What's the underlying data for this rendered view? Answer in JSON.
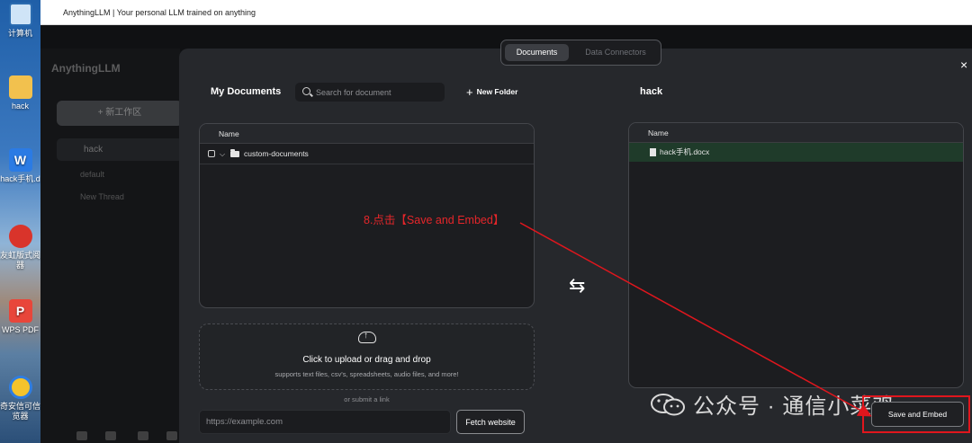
{
  "browser": {
    "title": "AnythingLLM | Your personal LLM trained on anything"
  },
  "desktop": {
    "icons": [
      {
        "label": "计算机"
      },
      {
        "label": "hack"
      },
      {
        "label": "hack手机.d"
      },
      {
        "label": "友虹版式阅器"
      },
      {
        "label": "WPS PDF"
      },
      {
        "label": "奇安信可信览器"
      }
    ]
  },
  "sidebar": {
    "logo": "AnythingLLM",
    "new_workspace": "+ 新工作区",
    "workspace": "hack",
    "threads": [
      "default",
      "New Thread"
    ]
  },
  "tabs": {
    "documents": "Documents",
    "connectors": "Data Connectors"
  },
  "left_panel": {
    "title": "My Documents",
    "search_placeholder": "Search for document",
    "new_folder": "New Folder",
    "column": "Name",
    "folders": [
      "custom-documents"
    ]
  },
  "upload": {
    "title": "Click to upload or drag and drop",
    "subtitle": "supports text files, csv's, spreadsheets, audio files, and more!",
    "or_link": "or submit a link",
    "url_placeholder": "https://example.com",
    "fetch_label": "Fetch website"
  },
  "right_panel": {
    "title": "hack",
    "column": "Name",
    "files": [
      "hack手机.docx"
    ],
    "save_label": "Save and Embed"
  },
  "annotation": {
    "text": "8.点击【Save and Embed】",
    "color": "#e0161d"
  },
  "watermark": {
    "text": "公众号 · 通信小菜鸡"
  },
  "close_symbol": "×",
  "swap_symbol": "⇆"
}
